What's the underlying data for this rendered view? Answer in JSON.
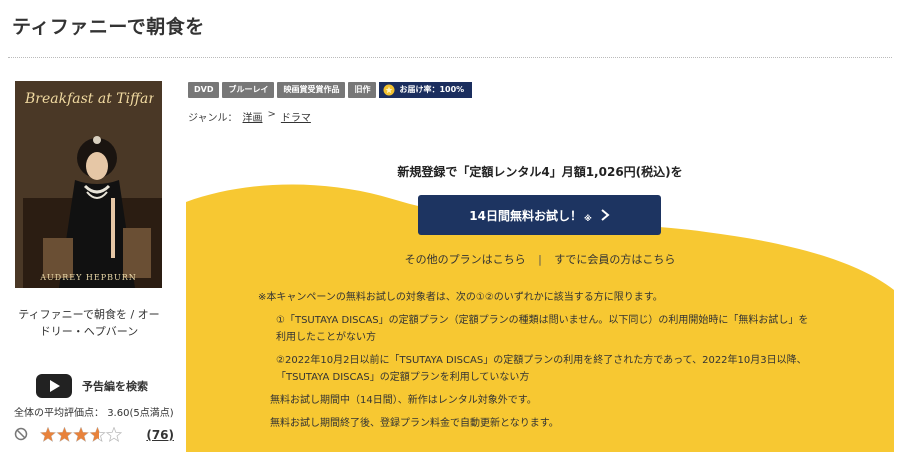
{
  "page": {
    "title": "ティファニーで朝食を"
  },
  "product": {
    "poster_title": "Breakfast at Tiffany's",
    "poster_credit": "AUDREY HEPBURN",
    "name": "ティファニーで朝食を / オードリー・ヘプバーン",
    "trailer_label": "予告編を検索",
    "rating_label": "全体の平均評価点：",
    "rating_value": "3.60(5点満点)",
    "rating_fraction": 0.72,
    "review_count": "(76)"
  },
  "tags": [
    "DVD",
    "ブルーレイ",
    "映画賞受賞作品",
    "旧作"
  ],
  "delivery": {
    "label": "お届け率：100%"
  },
  "genre": {
    "label": "ジャンル：",
    "items": [
      "洋画",
      "ドラマ"
    ],
    "separator": ">"
  },
  "campaign": {
    "heading": "新規登録で「定額レンタル4」月額1,026円(税込)を",
    "button_label": "14日間無料お試し！",
    "button_note": "※",
    "links": [
      "その他のプランはこちら",
      "すでに会員の方はこちら"
    ],
    "link_separator": "|",
    "terms": [
      "※本キャンペーンの無料お試しの対象者は、次の①②のいずれかに該当する方に限ります。",
      "①「TSUTAYA DISCAS」の定額プラン（定額プランの種類は問いません。以下同じ）の利用開始時に「無料お試し」を",
      "利用したことがない方",
      "②2022年10月2日以前に「TSUTAYA DISCAS」の定額プランの利用を終了された方であって、2022年10月3日以降、",
      "「TSUTAYA DISCAS」の定額プランを利用していない方",
      "無料お試し期間中（14日間）、新作はレンタル対象外です。",
      "無料お試し期間終了後、登録プラン料金で自動更新となります。"
    ]
  },
  "colors": {
    "accent_yellow": "#f7c832",
    "navy": "#1d3461",
    "star": "#e8823b"
  },
  "icons": {
    "play": "youtube-play-icon",
    "ban": "not-interested-icon",
    "medal": "gold-medal-icon",
    "chevron": "chevron-right-icon"
  }
}
